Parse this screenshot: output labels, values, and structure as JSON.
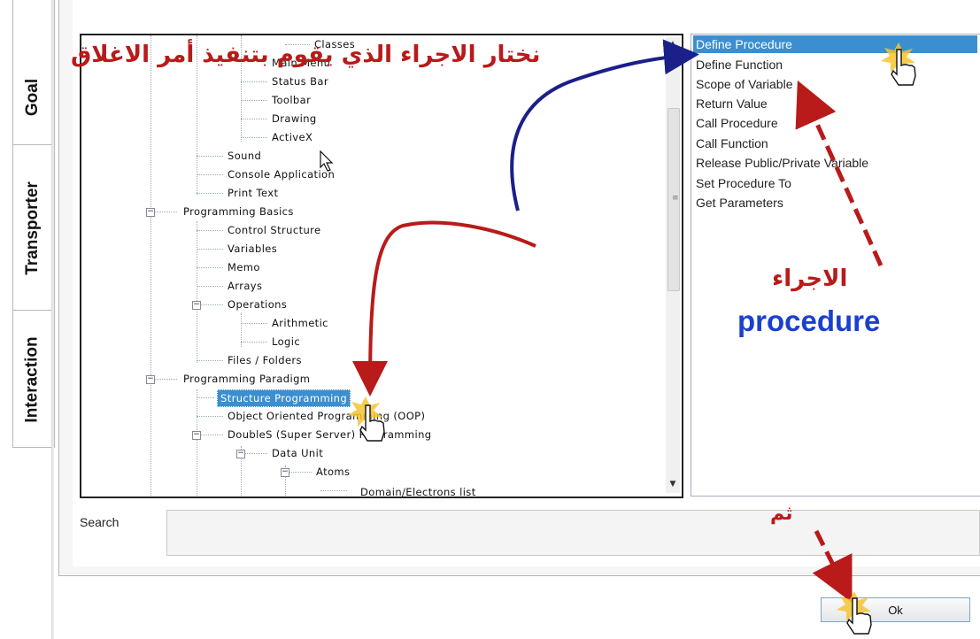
{
  "tabs": [
    {
      "label": "Goal"
    },
    {
      "label": "Transporter"
    },
    {
      "label": "Interaction"
    }
  ],
  "tree": {
    "items": [
      {
        "label": "Classes"
      },
      {
        "label": "Main Menu"
      },
      {
        "label": "Status Bar"
      },
      {
        "label": "Toolbar"
      },
      {
        "label": "Drawing"
      },
      {
        "label": "ActiveX"
      },
      {
        "label": "Sound"
      },
      {
        "label": "Console Application"
      },
      {
        "label": "Print Text"
      },
      {
        "label": "Programming Basics"
      },
      {
        "label": "Control Structure"
      },
      {
        "label": "Variables"
      },
      {
        "label": "Memo"
      },
      {
        "label": "Arrays"
      },
      {
        "label": "Operations"
      },
      {
        "label": "Arithmetic"
      },
      {
        "label": "Logic"
      },
      {
        "label": "Files / Folders"
      },
      {
        "label": "Programming Paradigm"
      },
      {
        "label": "Structure Programming"
      },
      {
        "label": "Object Oriented Programming (OOP)"
      },
      {
        "label": "DoubleS (Super Server) Programming"
      },
      {
        "label": "Data Unit"
      },
      {
        "label": "Atoms"
      },
      {
        "label": "Domain/Electrons list"
      }
    ],
    "selected": "Structure Programming"
  },
  "list": {
    "items": [
      {
        "label": "Define Procedure"
      },
      {
        "label": "Define Function"
      },
      {
        "label": "Scope of Variable"
      },
      {
        "label": "Return Value"
      },
      {
        "label": "Call Procedure"
      },
      {
        "label": "Call Function"
      },
      {
        "label": "Release Public/Private Variable"
      },
      {
        "label": "Set Procedure To"
      },
      {
        "label": "Get Parameters"
      }
    ],
    "selected": "Define Procedure"
  },
  "search": {
    "label": "Search",
    "value": ""
  },
  "ok_button": {
    "label": "Ok"
  },
  "annotations": {
    "top_arabic": "نختار الاجراء الذي يقوم بتنفيذ أمر الاغلاق",
    "procedure_arabic": "الاجراء",
    "procedure_english": "procedure",
    "then_arabic": "ثم"
  },
  "colors": {
    "selection": "#3b8fd0",
    "annotation_red": "#b91a1a",
    "annotation_blue": "#1b3fd0",
    "arrow_navy": "#1a1f8a"
  },
  "icons": [
    "hand-pointer-icon",
    "click-burst-icon",
    "mouse-arrow-cursor-icon",
    "scroll-up-arrow-icon",
    "scroll-down-arrow-icon",
    "expand-collapse-icon"
  ]
}
